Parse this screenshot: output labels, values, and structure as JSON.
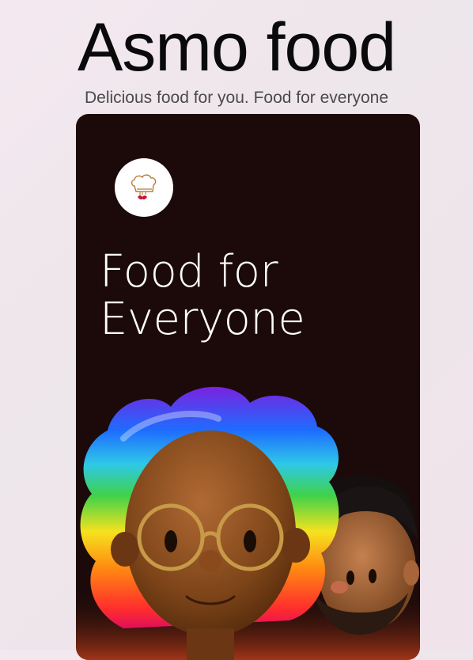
{
  "header": {
    "title": "Asmo food",
    "subtitle": "Delicious food for you. Food for everyone"
  },
  "card": {
    "headline_line1": "Food for",
    "headline_line2": "Everyone",
    "logo_icon": "chef-hat-icon",
    "illustration": "characters-illustration"
  },
  "colors": {
    "card_background": "#1c0a0a",
    "headline": "#ffffff",
    "title": "#0a0a0a",
    "subtitle": "#4a4a4a"
  }
}
